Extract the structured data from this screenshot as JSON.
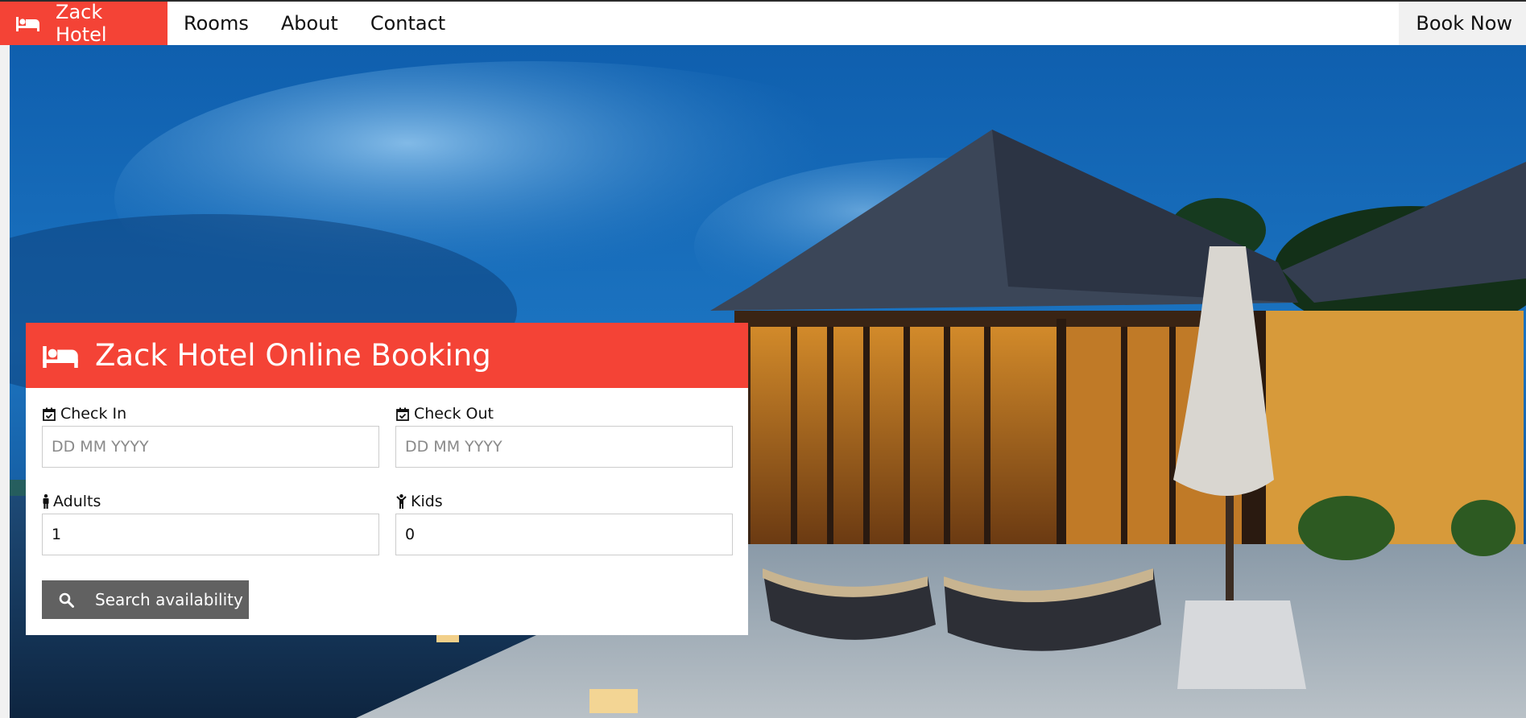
{
  "nav": {
    "brand_label": "Zack Hotel",
    "brand_icon": "bed-icon",
    "links": [
      {
        "label": "Rooms"
      },
      {
        "label": "About"
      },
      {
        "label": "Contact"
      }
    ],
    "book_now_label": "Book Now"
  },
  "hero": {
    "image_subject": "resort-villa-at-dusk"
  },
  "booking": {
    "title": "Zack Hotel Online Booking",
    "title_icon": "bed-icon",
    "check_in": {
      "label": "Check In",
      "placeholder": "DD MM YYYY",
      "icon": "calendar-check-icon"
    },
    "check_out": {
      "label": "Check Out",
      "placeholder": "DD MM YYYY",
      "icon": "calendar-check-icon"
    },
    "adults": {
      "label": "Adults",
      "value": "1",
      "icon": "male-icon"
    },
    "kids": {
      "label": "Kids",
      "value": "0",
      "icon": "child-icon"
    },
    "search_label": "Search availability",
    "search_icon": "search-icon"
  },
  "colors": {
    "accent": "#f44336",
    "button": "#616161",
    "navbar_bg": "#ffffff",
    "book_now_bg": "#f1f1f1"
  }
}
